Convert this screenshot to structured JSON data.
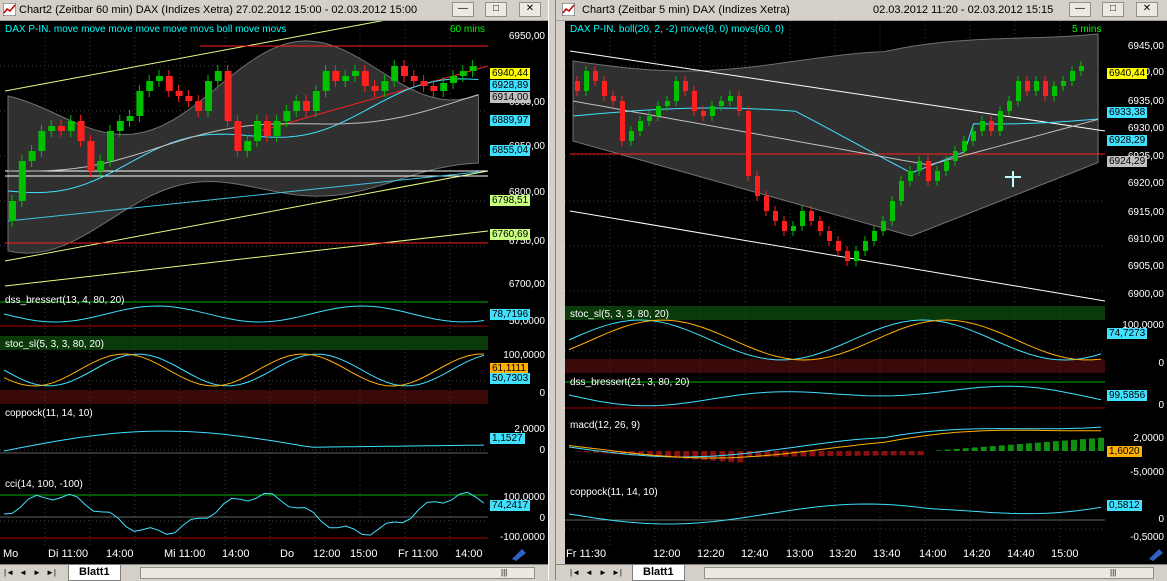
{
  "left": {
    "title": "Chart2 (Zeitbar 60 min)  DAX (Indizes Xetra) 27.02.2012 15:00 - 02.03.2012 15:00",
    "minimize": "—",
    "restore": "□",
    "close": "✕",
    "price_label": "DAX P-IN.  move move move move move movs boll move movs",
    "timeframe": "60 mins",
    "price_ticks": [
      "6950,00",
      "6900,00",
      "6850,00",
      "6800,00",
      "6750,00",
      "6700,00"
    ],
    "price_badges": [
      {
        "text": "6940,44",
        "color": "#ffff00"
      },
      {
        "text": "6928,89",
        "color": "#40e0ff"
      },
      {
        "text": "6914,00",
        "color": "#c0c0c0"
      },
      {
        "text": "6889,97",
        "color": "#40e0ff"
      },
      {
        "text": "6855,04",
        "color": "#40e0ff"
      },
      {
        "text": "6798,51",
        "color": "#c8ff80"
      },
      {
        "text": "6760,69",
        "color": "#c8ff80"
      }
    ],
    "panels": [
      {
        "label": "dss_bressert(13, 4, 80, 20)",
        "ticks": [
          "50,0000"
        ],
        "badge": "78,7196",
        "badge_color": "#40e0ff"
      },
      {
        "label": "stoc_sl(5, 3, 3, 80, 20)",
        "ticks": [
          "100,0000",
          "0"
        ],
        "badge": "50,7303",
        "badge_color": "#40e0ff",
        "badge2": "61,1111",
        "badge2_color": "#ffb000"
      },
      {
        "label": "coppock(11, 14, 10)",
        "ticks": [
          "2,0000",
          "0"
        ],
        "badge": "1,1527",
        "badge_color": "#40e0ff"
      },
      {
        "label": "cci(14, 100, -100)",
        "ticks": [
          "100,0000",
          "0",
          "-100,0000"
        ],
        "badge": "74,2417",
        "badge_color": "#40e0ff"
      }
    ],
    "x_labels": [
      "Mo",
      "Di 11:00",
      "14:00",
      "Mi 11:00",
      "14:00",
      "Do",
      "12:00",
      "15:00",
      "Fr 11:00",
      "14:00"
    ],
    "sheet_tab": "Blatt1",
    "nav": [
      "|◄",
      "◄",
      "►",
      "►|"
    ],
    "scroll_mid": "|||"
  },
  "right": {
    "title": "Chart3 (Zeitbar 5 min)  DAX (Indizes Xetra)",
    "time_range": "02.03.2012 11:20 - 02.03.2012 15:15",
    "minimize": "—",
    "restore": "□",
    "close": "✕",
    "price_label": "DAX P-IN.  boll(20, 2, -2) move(9, 0) movs(60, 0)",
    "timeframe": "5 mins",
    "price_ticks": [
      "6945,00",
      "6940,00",
      "6935,00",
      "6930,00",
      "6925,00",
      "6920,00",
      "6915,00",
      "6910,00",
      "6905,00",
      "6900,00"
    ],
    "price_badges": [
      {
        "text": "6940,44",
        "color": "#ffff00"
      },
      {
        "text": "6933,38",
        "color": "#40e0ff"
      },
      {
        "text": "6928,29",
        "color": "#40e0ff"
      },
      {
        "text": "6924,29",
        "color": "#c0c0c0"
      }
    ],
    "panels": [
      {
        "label": "stoc_sl(5, 3, 3, 80, 20)",
        "ticks": [
          "100,0000",
          "0"
        ],
        "badge": "74,7273",
        "badge_color": "#40e0ff"
      },
      {
        "label": "dss_bressert(21, 3, 80, 20)",
        "ticks": [
          "0"
        ],
        "badge": "99,5856",
        "badge_color": "#40e0ff"
      },
      {
        "label": "macd(12, 26, 9)",
        "ticks": [
          "2,0000",
          "-5,0000"
        ],
        "badge": "1,6020",
        "badge_color": "#ffb000"
      },
      {
        "label": "coppock(11, 14, 10)",
        "ticks": [
          "0",
          "-0,5000"
        ],
        "badge": "0,5812",
        "badge_color": "#40e0ff"
      }
    ],
    "x_labels": [
      "Fr  11:30",
      "12:00",
      "12:20",
      "12:40",
      "13:00",
      "13:20",
      "13:40",
      "14:00",
      "14:20",
      "14:40",
      "15:00"
    ],
    "sheet_tab": "Blatt1",
    "nav": [
      "|◄",
      "◄",
      "►",
      "►|"
    ],
    "scroll_mid": "|||"
  }
}
